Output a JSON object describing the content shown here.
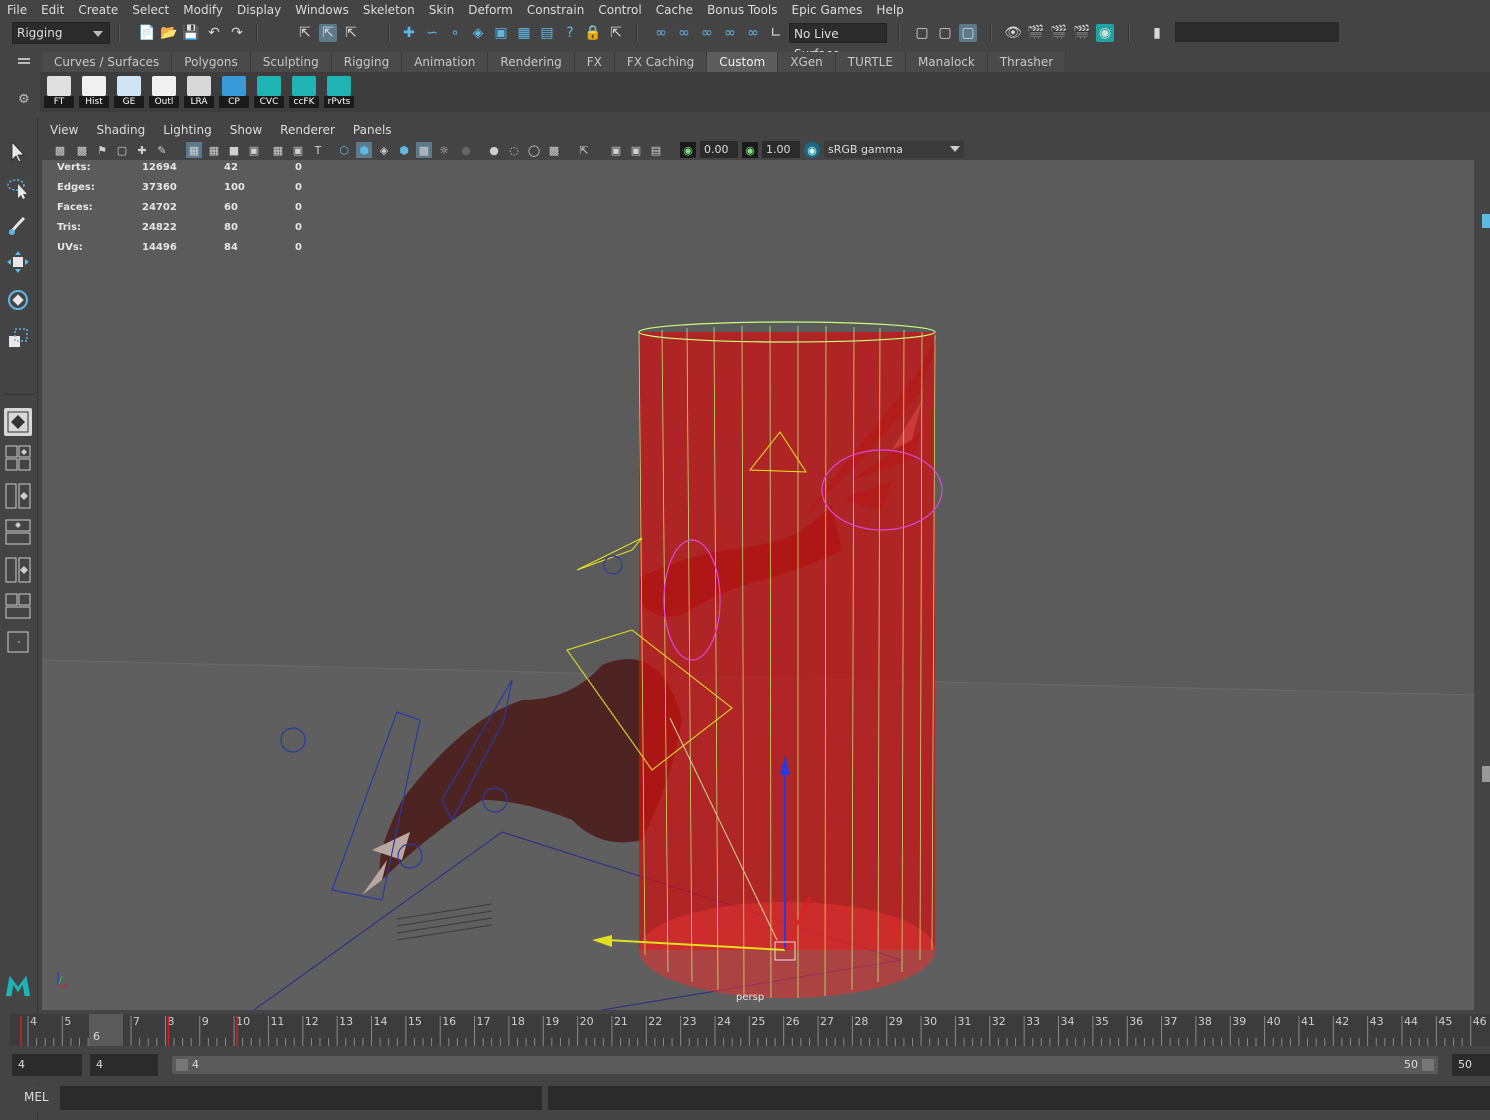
{
  "menubar": [
    "File",
    "Edit",
    "Create",
    "Select",
    "Modify",
    "Display",
    "Windows",
    "Skeleton",
    "Skin",
    "Deform",
    "Constrain",
    "Control",
    "Cache",
    "Bonus Tools",
    "Epic Games",
    "Help"
  ],
  "status_line": {
    "menu_set": "Rigging",
    "live_surface": "No Live Surface"
  },
  "shelf": {
    "tabs": [
      "Curves / Surfaces",
      "Polygons",
      "Sculpting",
      "Rigging",
      "Animation",
      "Rendering",
      "FX",
      "FX Caching",
      "Custom",
      "XGen",
      "TURTLE",
      "Manalock",
      "Thrasher"
    ],
    "active_tab": "Custom",
    "buttons": [
      "FT",
      "Hist",
      "GE",
      "Outl",
      "LRA",
      "CP",
      "CVC",
      "ccFK",
      "rPvts"
    ]
  },
  "panel_menu": [
    "View",
    "Shading",
    "Lighting",
    "Show",
    "Renderer",
    "Panels"
  ],
  "panel_toolbar": {
    "exposure": "0.00",
    "gamma": "1.00",
    "color_space": "sRGB gamma"
  },
  "hud": {
    "rows": [
      {
        "label": "Verts:",
        "total": "12694",
        "selected": "42",
        "extra": "0"
      },
      {
        "label": "Edges:",
        "total": "37360",
        "selected": "100",
        "extra": "0"
      },
      {
        "label": "Faces:",
        "total": "24702",
        "selected": "60",
        "extra": "0"
      },
      {
        "label": "Tris:",
        "total": "24822",
        "selected": "80",
        "extra": "0"
      },
      {
        "label": "UVs:",
        "total": "14496",
        "selected": "84",
        "extra": "0"
      }
    ],
    "camera": "persp"
  },
  "timeline": {
    "ticks": [
      "4",
      "5",
      "6",
      "7",
      "8",
      "9",
      "10",
      "11",
      "12",
      "13",
      "14",
      "15",
      "16",
      "17",
      "18",
      "19",
      "20",
      "21",
      "22",
      "23",
      "24",
      "25",
      "26",
      "27",
      "28",
      "29",
      "30",
      "31",
      "32",
      "33",
      "34",
      "35",
      "36",
      "37",
      "38",
      "39",
      "40",
      "41",
      "42",
      "43",
      "44",
      "45",
      "46"
    ],
    "current_frame": "6"
  },
  "range_slider": {
    "start_time": "4",
    "playback_start": "4",
    "range_start": "4",
    "range_end": "50",
    "end_time": "50"
  },
  "command_line": {
    "language": "MEL"
  },
  "colors": {
    "accent": "#5fb7e6",
    "cylinder": "#d01010",
    "wire": "#c8ff7a",
    "creature": "#5a2a28"
  }
}
